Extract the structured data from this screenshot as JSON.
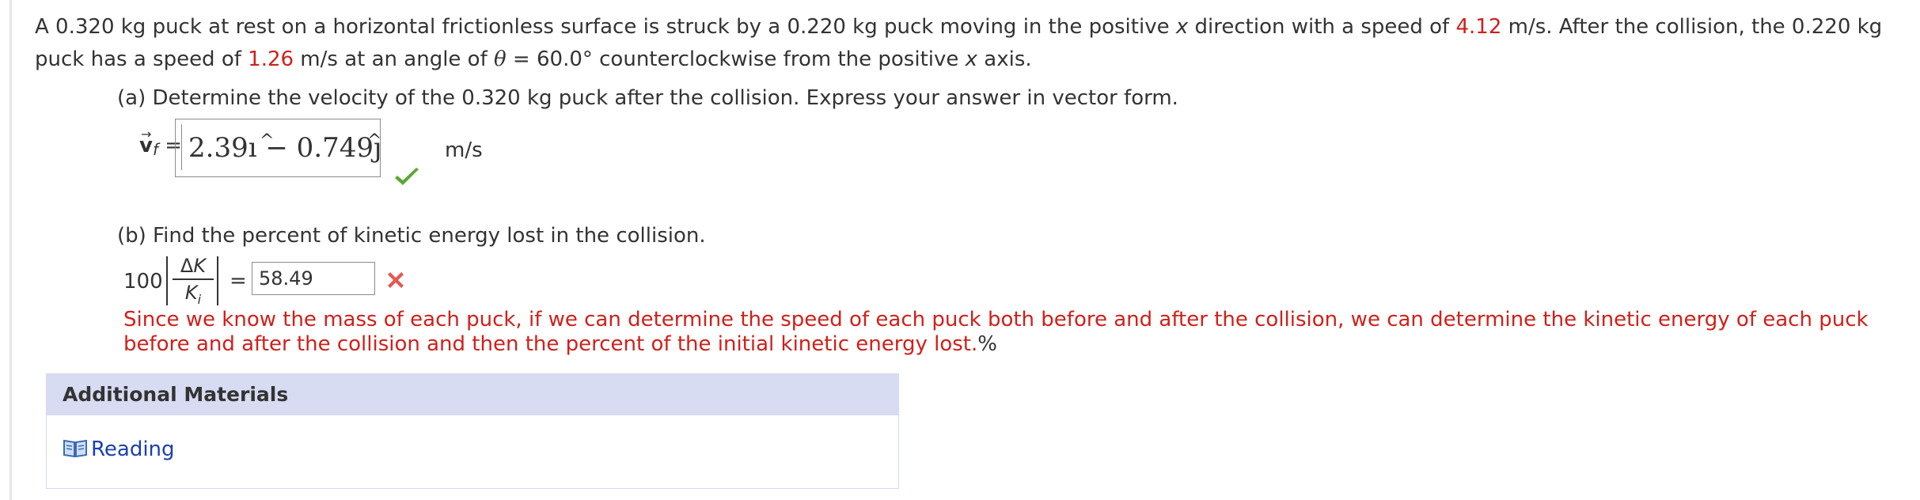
{
  "problem": {
    "seg1": "A 0.320 kg puck at rest on a horizontal frictionless surface is struck by a 0.220 kg puck moving in the positive ",
    "x1": "x",
    "seg2": " direction with a speed of ",
    "speed1": "4.12",
    "seg3": " m/s. After the collision, the 0.220 kg puck has a speed of ",
    "speed2": "1.26",
    "seg4": " m/s at an angle of ",
    "theta": "θ",
    "seg5": " = 60.0° counterclockwise from the positive ",
    "x2": "x",
    "seg6": " axis."
  },
  "part_a": {
    "label": "(a) Determine the velocity of the 0.320 kg puck after the collision. Express your answer in vector form.",
    "var_letter": "v",
    "var_sub": "f",
    "equals": " =",
    "answer": "2.39ı − 0.749ȷ",
    "hat": "^",
    "unit": "m/s",
    "status_icon": "check-icon"
  },
  "part_b": {
    "label": "(b) Find the percent of kinetic energy lost in the collision.",
    "coefficient": "100",
    "numerator_delta": "Δ",
    "numerator_var": "K",
    "denominator_var": "K",
    "denominator_sub": "i",
    "equals": "=",
    "input_value": "58.49",
    "status_icon": "x-icon",
    "feedback": "Since we know the mass of each puck, if we can determine the speed of each puck both before and after the collision, we can determine the kinetic energy of each puck before and after the collision and then the percent of the initial kinetic energy lost.",
    "unit": "%"
  },
  "additional_materials": {
    "header": "Additional Materials",
    "link_label": "Reading",
    "link_icon": "book-icon"
  },
  "colors": {
    "highlight_red": "#d0201b",
    "panel_header": "#d7dcf2",
    "link_blue": "#1a3fb0",
    "check_green": "#5aa832"
  }
}
